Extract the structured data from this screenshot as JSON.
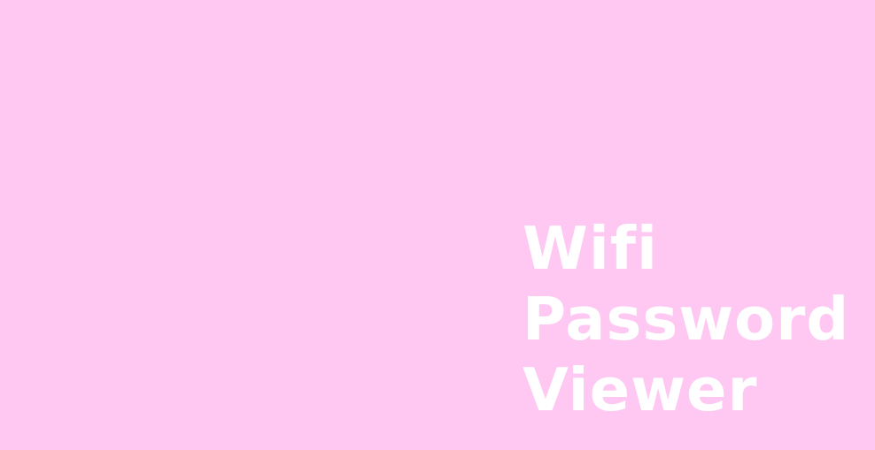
{
  "background_color": "#ffc8f3",
  "text_color": "#ffffff",
  "title": {
    "lines": [
      "Wifi",
      "Password",
      "Viewer"
    ]
  }
}
